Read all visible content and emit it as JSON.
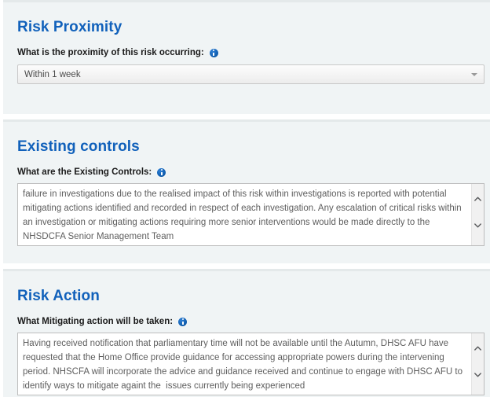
{
  "theme": {
    "heading_color": "#1161bb",
    "panel_bg": "#f0f4f5",
    "panel_top_strip": "#e4e9ea",
    "page_bg": "#ffffff",
    "field_text_color": "#5e5e5e",
    "info_icon_color": "#1463b5"
  },
  "sections": [
    {
      "title": "Risk Proximity",
      "field": {
        "label": "What is the proximity of this risk occurring:",
        "info_icon": "info-icon",
        "control": "dropdown",
        "value": "Within 1 week",
        "arrow_icon": "chevron-down-icon"
      }
    },
    {
      "title": "Existing controls",
      "field": {
        "label": "What are the Existing Controls:",
        "info_icon": "info-icon",
        "control": "textarea",
        "value": "failure in investigations due to the realised impact of this risk within investigations is reported with potential mitigating actions identified and recorded in respect of each investigation. Any escalation of critical risks within an investigation or mitigating actions requiring more senior interventions would be made directly to the NHSDCFA Senior Management Team",
        "scroll_up_icon": "chevron-up-icon",
        "scroll_down_icon": "chevron-down-icon"
      }
    },
    {
      "title": "Risk Action",
      "field": {
        "label": "What Mitigating action will be taken:",
        "info_icon": "info-icon",
        "control": "textarea",
        "value": "Having received notification that parliamentary time will not be available until the Autumn, DHSC AFU have requested that the Home Office provide guidance for accessing appropriate powers during the intervening period. NHSCFA will incorporate the advice and guidance received and continue to engage with DHSC AFU to identify ways to mitigate againt the  issues currently being experienced",
        "scroll_up_icon": "chevron-up-icon",
        "scroll_down_icon": "chevron-down-icon"
      }
    }
  ]
}
